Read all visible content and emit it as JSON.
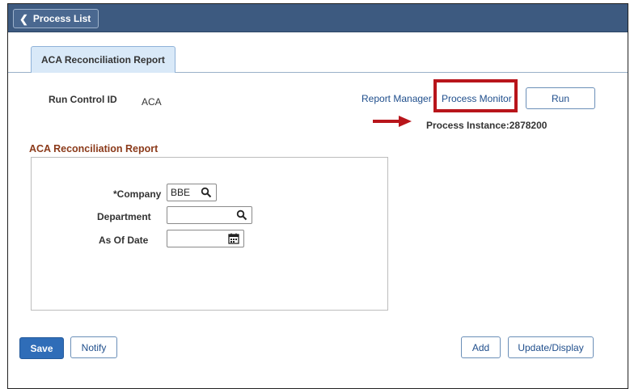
{
  "header": {
    "back_label": "Process List"
  },
  "tabs": [
    {
      "label": "ACA Reconciliation Report"
    }
  ],
  "run_control": {
    "label": "Run Control ID",
    "value": "ACA"
  },
  "links": {
    "report_manager": "Report Manager",
    "process_monitor": "Process Monitor"
  },
  "run_button": "Run",
  "process_instance": "Process Instance:2878200",
  "section_title": "ACA Reconciliation Report",
  "form": {
    "company": {
      "label": "*Company",
      "value": "BBE"
    },
    "department": {
      "label": "Department",
      "value": ""
    },
    "as_of_date": {
      "label": "As Of Date",
      "value": ""
    }
  },
  "footer": {
    "save": "Save",
    "notify": "Notify",
    "add": "Add",
    "update_display": "Update/Display"
  },
  "colors": {
    "topbar": "#3d5a80",
    "highlight": "#b8151b",
    "section_title": "#8b3a1a",
    "primary_button": "#2f6db8"
  },
  "icons": [
    "chevron-left-icon",
    "search-icon",
    "calendar-icon",
    "arrow-right-icon"
  ]
}
